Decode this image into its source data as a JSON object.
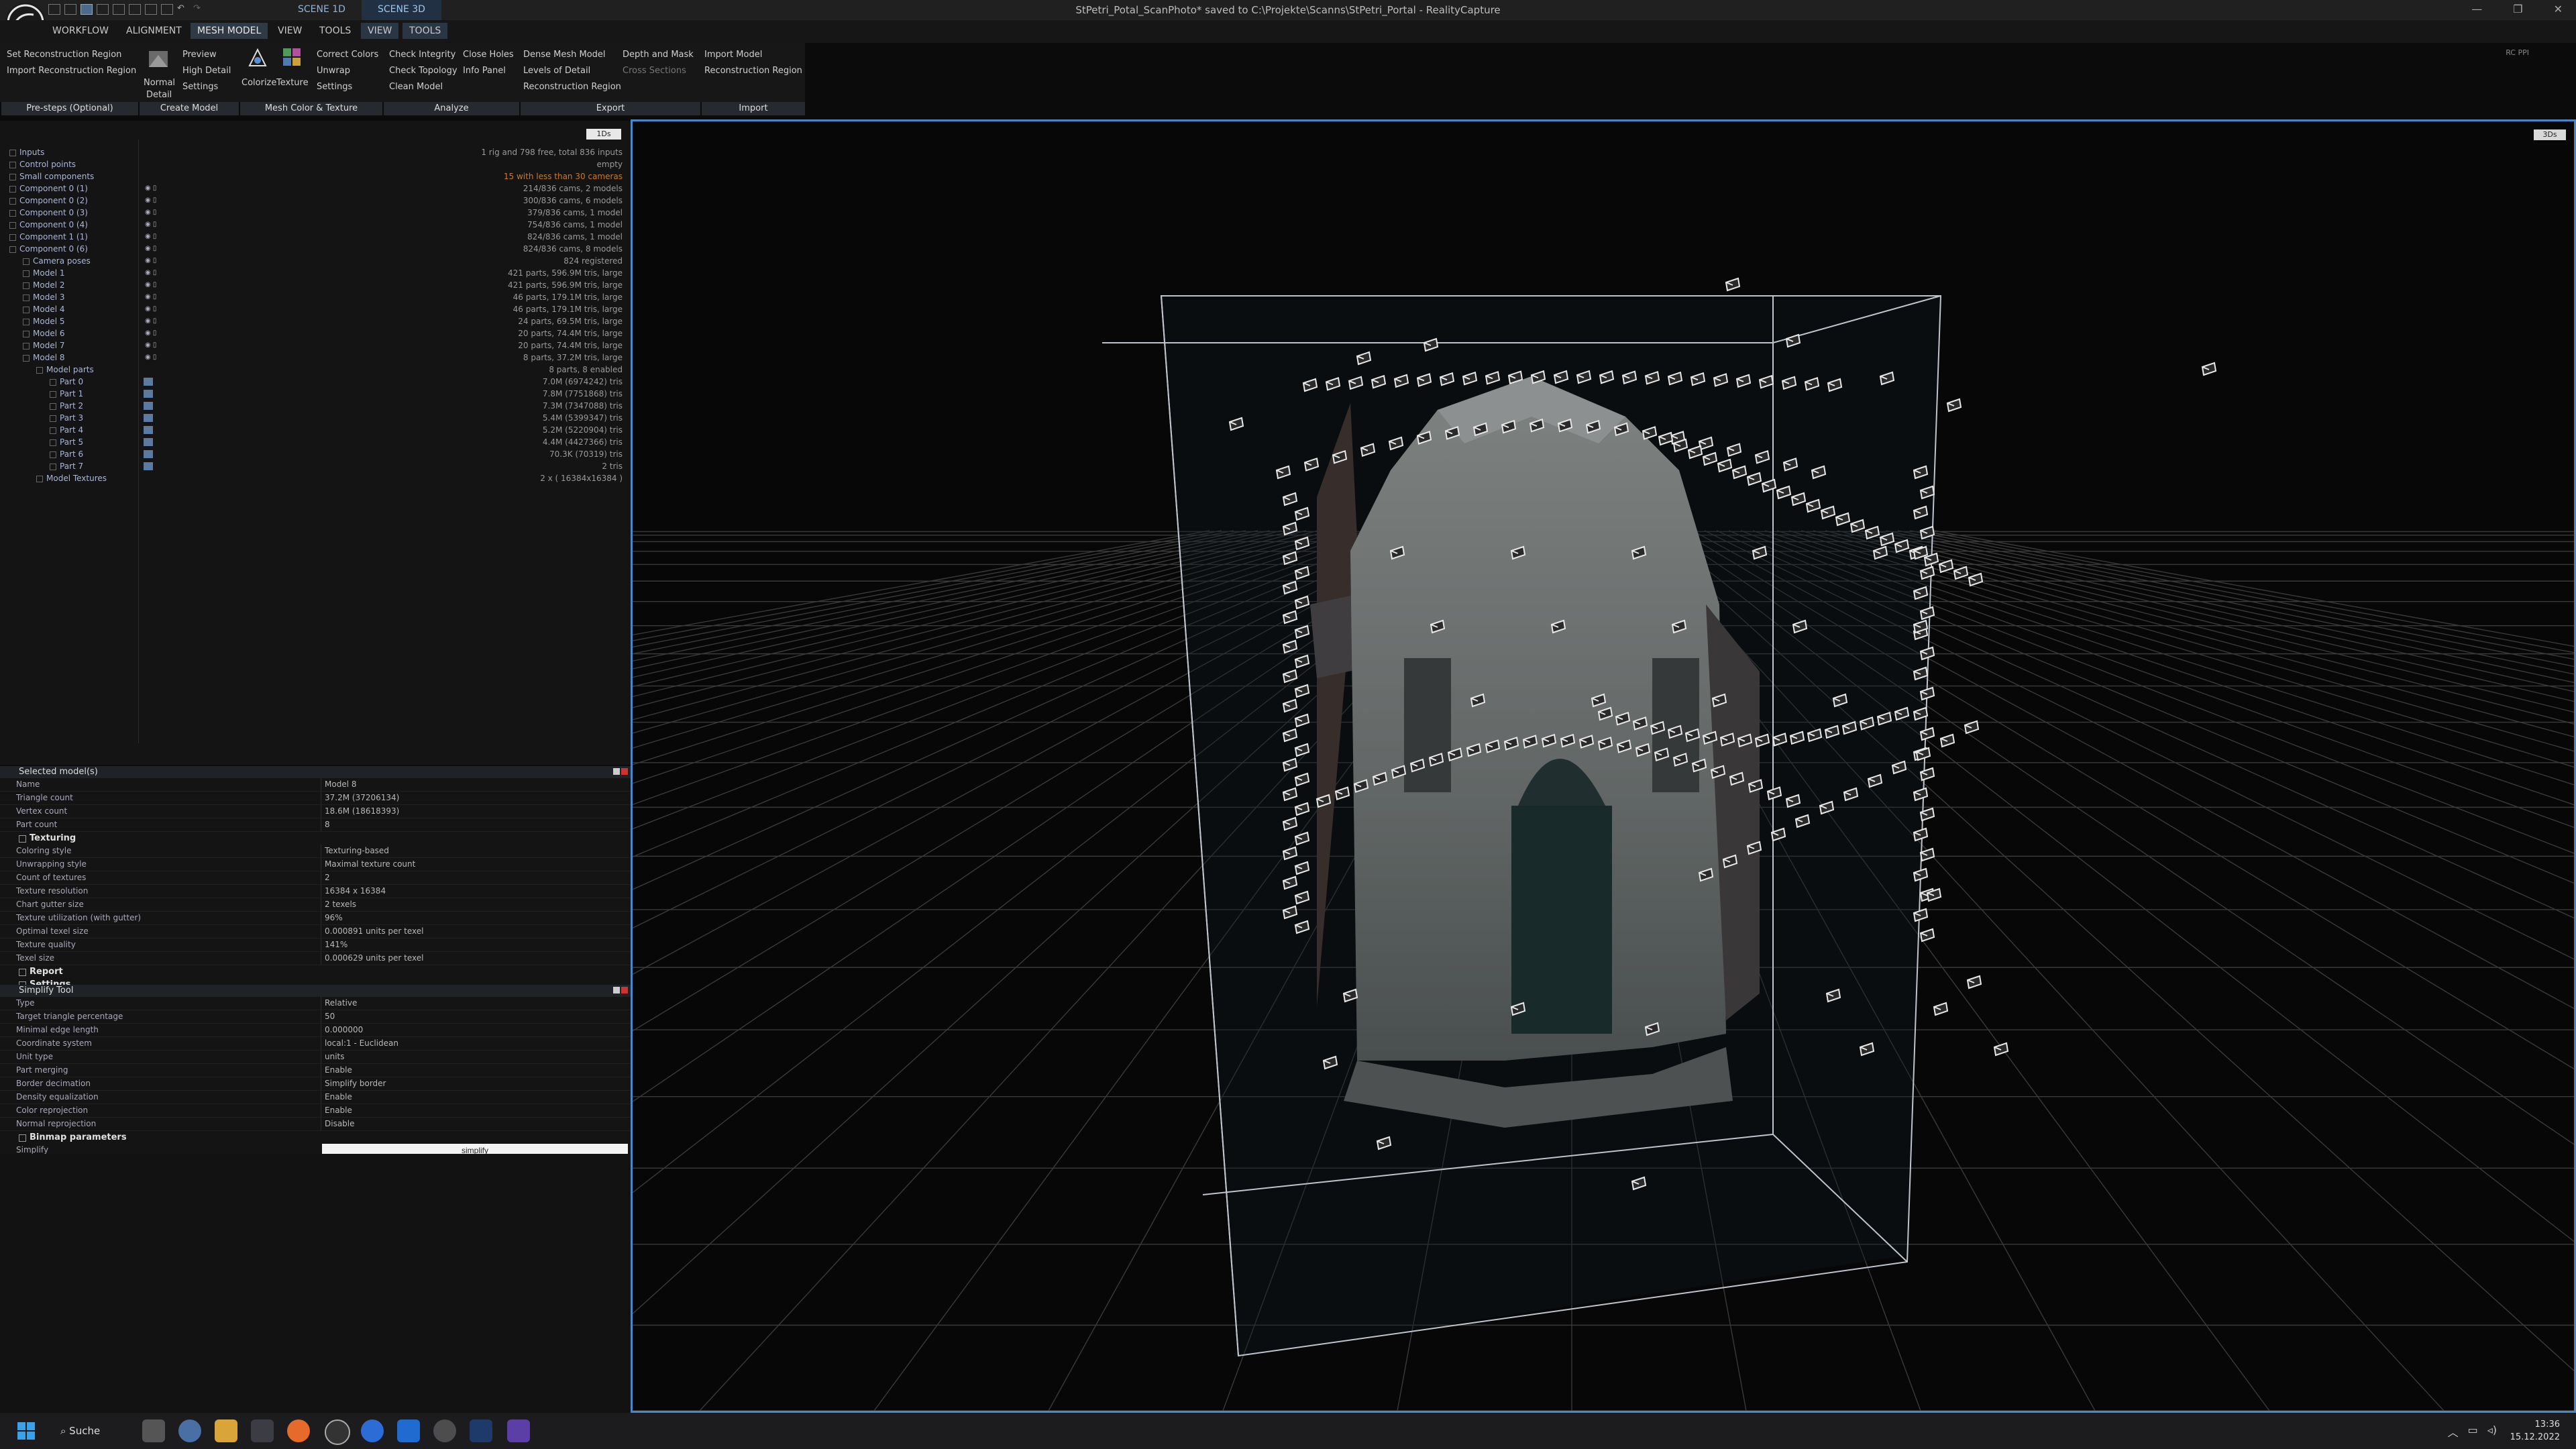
{
  "window": {
    "title": "StPetri_Potal_ScanPhoto* saved to C:\\Projekte\\Scanns\\StPetri_Portal - RealityCapture",
    "controls": [
      "—",
      "❐",
      "✕"
    ]
  },
  "scene_tabs": [
    "SCENE 1D",
    "SCENE 3D"
  ],
  "menu": {
    "tabs": [
      "WORKFLOW",
      "ALIGNMENT",
      "MESH MODEL",
      "VIEW",
      "TOOLS"
    ],
    "view_tabs": [
      "VIEW",
      "TOOLS"
    ],
    "rc_label": "RC PPI"
  },
  "ribbon": {
    "pre_steps": [
      "Set Reconstruction Region",
      "Import Reconstruction Region"
    ],
    "create": [
      "Normal",
      "Detail",
      "Preview",
      "High Detail",
      "Settings"
    ],
    "color": [
      "Colorize",
      "Texture",
      "Correct Colors",
      "Unwrap",
      "Settings"
    ],
    "analyze": [
      "Check Integrity",
      "Check Topology",
      "Clean Model",
      "Close Holes",
      "Info Panel"
    ],
    "export": [
      "Dense Mesh Model",
      "Levels of Detail",
      "Reconstruction Region",
      "Depth and Mask",
      "Cross Sections"
    ],
    "import": [
      "Import Model",
      "Reconstruction Region"
    ],
    "sections": [
      "Pre-steps (Optional)",
      "Create Model",
      "Mesh Color & Texture",
      "Analyze",
      "Export",
      "Import"
    ]
  },
  "tree_panel": {
    "btn": "1Ds",
    "rows": [
      {
        "label": "Inputs",
        "info": "1 rig and 798 free, total 836 inputs",
        "warn": false,
        "indent": 0
      },
      {
        "label": "Control points",
        "info": "empty",
        "warn": false,
        "indent": 0
      },
      {
        "label": "Small components",
        "info": "15 with less than 30 cameras",
        "warn": true,
        "indent": 0
      },
      {
        "label": "Component 0 (1)",
        "info": "214/836 cams, 2 models",
        "warn": false,
        "indent": 0
      },
      {
        "label": "Component 0 (2)",
        "info": "300/836 cams, 6 models",
        "warn": false,
        "indent": 0
      },
      {
        "label": "Component 0 (3)",
        "info": "379/836 cams, 1 model",
        "warn": false,
        "indent": 0
      },
      {
        "label": "Component 0 (4)",
        "info": "754/836 cams, 1 model",
        "warn": false,
        "indent": 0
      },
      {
        "label": "Component 1 (1)",
        "info": "824/836 cams, 1 model",
        "warn": false,
        "indent": 0
      },
      {
        "label": "Component 0 (6)",
        "info": "824/836 cams, 8 models",
        "warn": false,
        "indent": 0
      },
      {
        "label": "Camera poses",
        "info": "824 registered",
        "warn": false,
        "indent": 1
      },
      {
        "label": "Model 1",
        "info": "421 parts, 596.9M tris, large",
        "warn": false,
        "indent": 1
      },
      {
        "label": "Model 2",
        "info": "421 parts, 596.9M tris, large",
        "warn": false,
        "indent": 1
      },
      {
        "label": "Model 3",
        "info": "46 parts, 179.1M tris, large",
        "warn": false,
        "indent": 1
      },
      {
        "label": "Model 4",
        "info": "46 parts, 179.1M tris, large",
        "warn": false,
        "indent": 1
      },
      {
        "label": "Model 5",
        "info": "24 parts, 69.5M tris, large",
        "warn": false,
        "indent": 1
      },
      {
        "label": "Model 6",
        "info": "20 parts, 74.4M tris, large",
        "warn": false,
        "indent": 1
      },
      {
        "label": "Model 7",
        "info": "20 parts, 74.4M tris, large",
        "warn": false,
        "indent": 1
      },
      {
        "label": "Model 8",
        "info": "8 parts, 37.2M tris, large",
        "warn": false,
        "indent": 1
      },
      {
        "label": "Model parts",
        "info": "8 parts, 8 enabled",
        "warn": false,
        "indent": 2
      },
      {
        "label": "Part 0",
        "info": "7.0M (6974242) tris",
        "warn": false,
        "indent": 3
      },
      {
        "label": "Part 1",
        "info": "7.8M (7751868) tris",
        "warn": false,
        "indent": 3
      },
      {
        "label": "Part 2",
        "info": "7.3M (7347088) tris",
        "warn": false,
        "indent": 3
      },
      {
        "label": "Part 3",
        "info": "5.4M (5399347) tris",
        "warn": false,
        "indent": 3
      },
      {
        "label": "Part 4",
        "info": "5.2M (5220904) tris",
        "warn": false,
        "indent": 3
      },
      {
        "label": "Part 5",
        "info": "4.4M (4427366) tris",
        "warn": false,
        "indent": 3
      },
      {
        "label": "Part 6",
        "info": "70.3K (70319) tris",
        "warn": false,
        "indent": 3
      },
      {
        "label": "Part 7",
        "info": "2 tris",
        "warn": false,
        "indent": 3
      },
      {
        "label": "Model Textures",
        "info": "2 x ( 16384x16384 )",
        "warn": false,
        "indent": 2
      }
    ]
  },
  "selected_model": {
    "header": "Selected model(s)",
    "rows": [
      {
        "k": "Name",
        "v": "Model 8"
      },
      {
        "k": "Triangle count",
        "v": "37.2M (37206134)"
      },
      {
        "k": "Vertex count",
        "v": "18.6M (18618393)"
      },
      {
        "k": "Part count",
        "v": "8"
      }
    ],
    "texturing_header": "Texturing",
    "texturing": [
      {
        "k": "Coloring style",
        "v": "Texturing-based"
      },
      {
        "k": "Unwrapping style",
        "v": "Maximal texture count"
      },
      {
        "k": "Count of textures",
        "v": "2"
      },
      {
        "k": "Texture resolution",
        "v": "16384 x 16384"
      },
      {
        "k": "Chart gutter size",
        "v": "2 texels"
      },
      {
        "k": "Texture utilization (with gutter)",
        "v": "96%"
      },
      {
        "k": "Optimal texel size",
        "v": "0.000891 units per texel"
      },
      {
        "k": "Texture quality",
        "v": "141%"
      },
      {
        "k": "Texel size",
        "v": "0.000629 units per texel"
      }
    ],
    "report": "Report",
    "settings": "Settings"
  },
  "simplify_tool": {
    "header": "Simplify Tool",
    "rows": [
      {
        "k": "Type",
        "v": "Relative"
      },
      {
        "k": "Target triangle percentage",
        "v": "50"
      },
      {
        "k": "Minimal edge length",
        "v": "0.000000"
      },
      {
        "k": "Coordinate system",
        "v": "local:1 - Euclidean"
      },
      {
        "k": "Unit type",
        "v": "units"
      },
      {
        "k": "Part merging",
        "v": "Enable"
      },
      {
        "k": "Border decimation",
        "v": "Simplify border"
      },
      {
        "k": "Density equalization",
        "v": "Enable"
      },
      {
        "k": "Color reprojection",
        "v": "Enable"
      },
      {
        "k": "Normal reprojection",
        "v": "Disable"
      }
    ],
    "binmap": "Binmap parameters",
    "simplify_label": "Simplify",
    "simplify_button": "simplify"
  },
  "viewport": {
    "btn": "3Ds"
  },
  "taskbar": {
    "search": "Suche",
    "time": "13:36",
    "date": "15.12.2022"
  }
}
